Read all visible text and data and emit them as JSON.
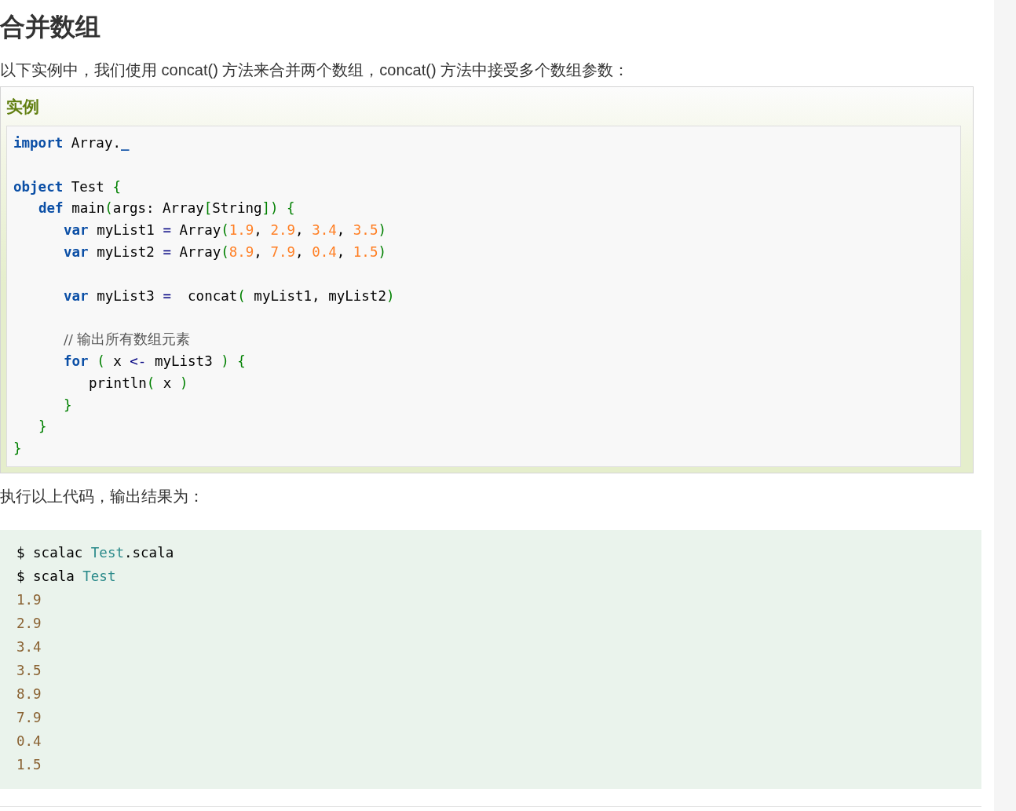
{
  "heading": "合并数组",
  "intro": "以下实例中，我们使用 concat() 方法来合并两个数组，concat() 方法中接受多个数组参数：",
  "example": {
    "title": "实例",
    "lines": [
      {
        "tokens": [
          {
            "kind": "kw",
            "t": "import"
          },
          {
            "kind": "plain",
            "t": " Array."
          },
          {
            "kind": "kw",
            "t": "_"
          }
        ]
      },
      {
        "gap_before": true,
        "tokens": [
          {
            "kind": "kw",
            "t": "object"
          },
          {
            "kind": "plain",
            "t": " Test "
          },
          {
            "kind": "punct",
            "t": "{"
          }
        ],
        "children": [
          {
            "tokens": [
              {
                "kind": "kw",
                "t": "def"
              },
              {
                "kind": "plain",
                "t": " main"
              },
              {
                "kind": "punct",
                "t": "("
              },
              {
                "kind": "plain",
                "t": "args: Array"
              },
              {
                "kind": "punct",
                "t": "["
              },
              {
                "kind": "plain",
                "t": "String"
              },
              {
                "kind": "punct",
                "t": "]) {"
              }
            ],
            "children": [
              {
                "tokens": [
                  {
                    "kind": "kw",
                    "t": "var"
                  },
                  {
                    "kind": "plain",
                    "t": " myList1 "
                  },
                  {
                    "kind": "op",
                    "t": "="
                  },
                  {
                    "kind": "plain",
                    "t": " Array"
                  },
                  {
                    "kind": "punct",
                    "t": "("
                  },
                  {
                    "kind": "num",
                    "t": "1.9"
                  },
                  {
                    "kind": "plain",
                    "t": ", "
                  },
                  {
                    "kind": "num",
                    "t": "2.9"
                  },
                  {
                    "kind": "plain",
                    "t": ", "
                  },
                  {
                    "kind": "num",
                    "t": "3.4"
                  },
                  {
                    "kind": "plain",
                    "t": ", "
                  },
                  {
                    "kind": "num",
                    "t": "3.5"
                  },
                  {
                    "kind": "punct",
                    "t": ")"
                  }
                ]
              },
              {
                "tokens": [
                  {
                    "kind": "kw",
                    "t": "var"
                  },
                  {
                    "kind": "plain",
                    "t": " myList2 "
                  },
                  {
                    "kind": "op",
                    "t": "="
                  },
                  {
                    "kind": "plain",
                    "t": " Array"
                  },
                  {
                    "kind": "punct",
                    "t": "("
                  },
                  {
                    "kind": "num",
                    "t": "8.9"
                  },
                  {
                    "kind": "plain",
                    "t": ", "
                  },
                  {
                    "kind": "num",
                    "t": "7.9"
                  },
                  {
                    "kind": "plain",
                    "t": ", "
                  },
                  {
                    "kind": "num",
                    "t": "0.4"
                  },
                  {
                    "kind": "plain",
                    "t": ", "
                  },
                  {
                    "kind": "num",
                    "t": "1.5"
                  },
                  {
                    "kind": "punct",
                    "t": ")"
                  }
                ]
              },
              {
                "gap_before": true,
                "tokens": [
                  {
                    "kind": "kw",
                    "t": "var"
                  },
                  {
                    "kind": "plain",
                    "t": " myList3 "
                  },
                  {
                    "kind": "op",
                    "t": "="
                  },
                  {
                    "kind": "plain",
                    "t": "  concat"
                  },
                  {
                    "kind": "punct",
                    "t": "("
                  },
                  {
                    "kind": "plain",
                    "t": " myList1, myList2"
                  },
                  {
                    "kind": "punct",
                    "t": ")"
                  }
                ]
              },
              {
                "gap_before": true,
                "tokens": [
                  {
                    "kind": "comment",
                    "t": "// 输出所有数组元素"
                  }
                ]
              },
              {
                "tokens": [
                  {
                    "kind": "kw",
                    "t": "for"
                  },
                  {
                    "kind": "punct",
                    "t": " ("
                  },
                  {
                    "kind": "plain",
                    "t": " x "
                  },
                  {
                    "kind": "op",
                    "t": "<-"
                  },
                  {
                    "kind": "plain",
                    "t": " myList3 "
                  },
                  {
                    "kind": "punct",
                    "t": ") {"
                  }
                ],
                "children": [
                  {
                    "tokens": [
                      {
                        "kind": "plain",
                        "t": "println"
                      },
                      {
                        "kind": "punct",
                        "t": "("
                      },
                      {
                        "kind": "plain",
                        "t": " x "
                      },
                      {
                        "kind": "punct",
                        "t": ")"
                      }
                    ]
                  }
                ]
              },
              {
                "tokens": [
                  {
                    "kind": "punct",
                    "t": "}"
                  }
                ]
              }
            ]
          },
          {
            "tokens": [
              {
                "kind": "punct",
                "t": "}"
              }
            ]
          }
        ]
      },
      {
        "tokens": [
          {
            "kind": "punct",
            "t": "}"
          }
        ]
      }
    ]
  },
  "result_intro": "执行以上代码，输出结果为：",
  "output": [
    [
      {
        "kind": "plain",
        "t": "$ scalac "
      },
      {
        "kind": "type",
        "t": "Test"
      },
      {
        "kind": "plain",
        "t": ".scala"
      }
    ],
    [
      {
        "kind": "plain",
        "t": "$ scala "
      },
      {
        "kind": "type",
        "t": "Test"
      }
    ],
    [
      {
        "kind": "num",
        "t": "1.9"
      }
    ],
    [
      {
        "kind": "num",
        "t": "2.9"
      }
    ],
    [
      {
        "kind": "num",
        "t": "3.4"
      }
    ],
    [
      {
        "kind": "num",
        "t": "3.5"
      }
    ],
    [
      {
        "kind": "num",
        "t": "8.9"
      }
    ],
    [
      {
        "kind": "num",
        "t": "7.9"
      }
    ],
    [
      {
        "kind": "num",
        "t": "0.4"
      }
    ],
    [
      {
        "kind": "num",
        "t": "1.5"
      }
    ]
  ]
}
